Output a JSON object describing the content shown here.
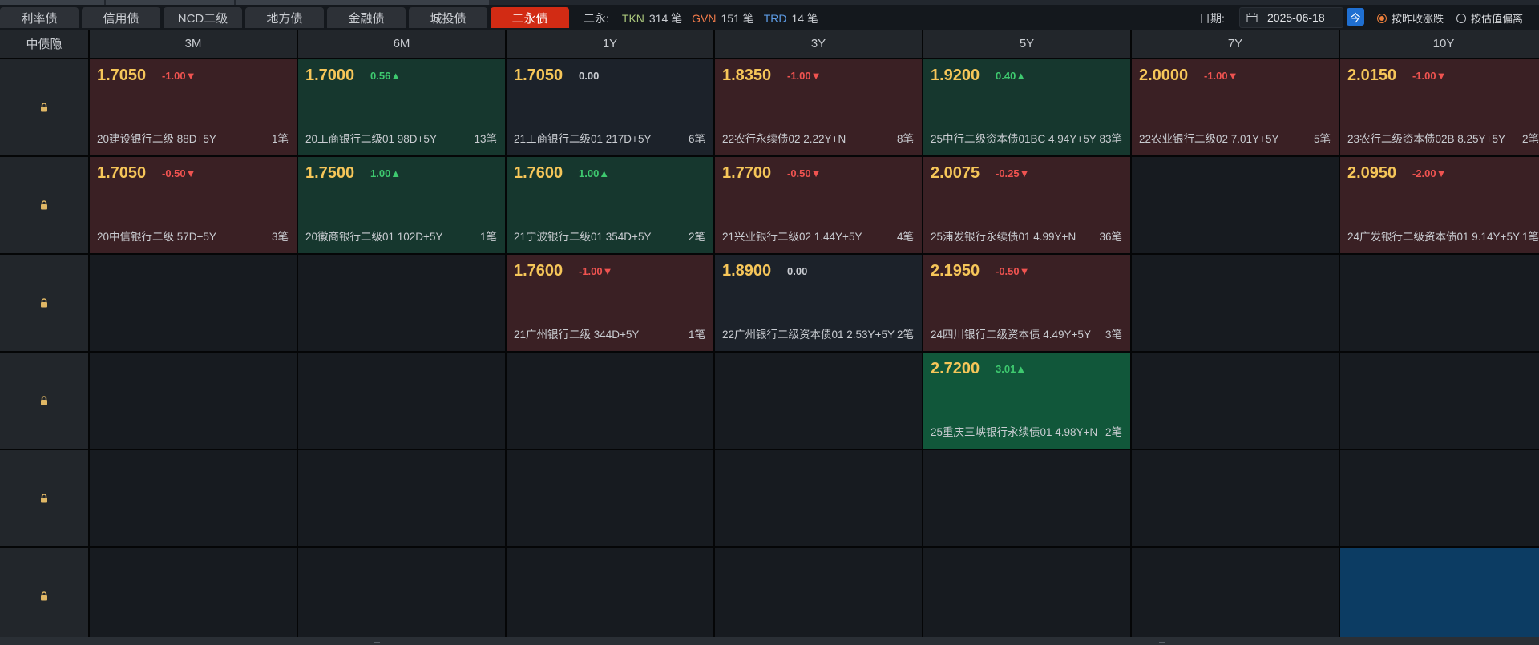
{
  "tabs": [
    {
      "label": "利率债",
      "active": false
    },
    {
      "label": "信用债",
      "active": false
    },
    {
      "label": "NCD二级",
      "active": false
    },
    {
      "label": "地方债",
      "active": false
    },
    {
      "label": "金融债",
      "active": false
    },
    {
      "label": "城投债",
      "active": false
    },
    {
      "label": "二永债",
      "active": true
    }
  ],
  "stats": {
    "prefix": "二永:",
    "tkn_label": "TKN",
    "tkn_count": "314 笔",
    "gvn_label": "GVN",
    "gvn_count": "151 笔",
    "trd_label": "TRD",
    "trd_count": "14 笔"
  },
  "date": {
    "label": "日期:",
    "value": "2025-06-18",
    "today_button": "今"
  },
  "radios": [
    {
      "label": "按昨收涨跌",
      "checked": true
    },
    {
      "label": "按估值偏离",
      "checked": false
    }
  ],
  "grid": {
    "corner_label": "中债隐",
    "columns": [
      "3M",
      "6M",
      "1Y",
      "3Y",
      "5Y",
      "7Y",
      "10Y"
    ],
    "rows": [
      [
        {
          "yield": "1.7050",
          "change": "-1.00▼",
          "dir": "dn",
          "bond": "20建设银行二级 88D+5Y",
          "count": "1笔",
          "tone": "red"
        },
        {
          "yield": "1.7000",
          "change": "0.56▲",
          "dir": "up",
          "bond": "20工商银行二级01 98D+5Y",
          "count": "13笔",
          "tone": "green"
        },
        {
          "yield": "1.7050",
          "change": "0.00",
          "dir": "flat",
          "bond": "21工商银行二级01 217D+5Y",
          "count": "6笔",
          "tone": "neutral"
        },
        {
          "yield": "1.8350",
          "change": "-1.00▼",
          "dir": "dn",
          "bond": "22农行永续债02 2.22Y+N",
          "count": "8笔",
          "tone": "red"
        },
        {
          "yield": "1.9200",
          "change": "0.40▲",
          "dir": "up",
          "bond": "25中行二级资本债01BC 4.94Y+5Y",
          "count": "83笔",
          "tone": "green"
        },
        {
          "yield": "2.0000",
          "change": "-1.00▼",
          "dir": "dn",
          "bond": "22农业银行二级02 7.01Y+5Y",
          "count": "5笔",
          "tone": "red"
        },
        {
          "yield": "2.0150",
          "change": "-1.00▼",
          "dir": "dn",
          "bond": "23农行二级资本债02B 8.25Y+5Y",
          "count": "2笔",
          "tone": "red"
        }
      ],
      [
        {
          "yield": "1.7050",
          "change": "-0.50▼",
          "dir": "dn",
          "bond": "20中信银行二级 57D+5Y",
          "count": "3笔",
          "tone": "red"
        },
        {
          "yield": "1.7500",
          "change": "1.00▲",
          "dir": "up",
          "bond": "20徽商银行二级01 102D+5Y",
          "count": "1笔",
          "tone": "green"
        },
        {
          "yield": "1.7600",
          "change": "1.00▲",
          "dir": "up",
          "bond": "21宁波银行二级01 354D+5Y",
          "count": "2笔",
          "tone": "green"
        },
        {
          "yield": "1.7700",
          "change": "-0.50▼",
          "dir": "dn",
          "bond": "21兴业银行二级02 1.44Y+5Y",
          "count": "4笔",
          "tone": "red"
        },
        {
          "yield": "2.0075",
          "change": "-0.25▼",
          "dir": "dn",
          "bond": "25浦发银行永续债01 4.99Y+N",
          "count": "36笔",
          "tone": "red"
        },
        null,
        {
          "yield": "2.0950",
          "change": "-2.00▼",
          "dir": "dn",
          "bond": "24广发银行二级资本债01 9.14Y+5Y",
          "count": "1笔",
          "tone": "red"
        }
      ],
      [
        null,
        null,
        {
          "yield": "1.7600",
          "change": "-1.00▼",
          "dir": "dn",
          "bond": "21广州银行二级 344D+5Y",
          "count": "1笔",
          "tone": "red"
        },
        {
          "yield": "1.8900",
          "change": "0.00",
          "dir": "flat",
          "bond": "22广州银行二级资本债01 2.53Y+5Y",
          "count": "2笔",
          "tone": "neutral"
        },
        {
          "yield": "2.1950",
          "change": "-0.50▼",
          "dir": "dn",
          "bond": "24四川银行二级资本债 4.49Y+5Y",
          "count": "3笔",
          "tone": "red"
        },
        null,
        null
      ],
      [
        null,
        null,
        null,
        null,
        {
          "yield": "2.7200",
          "change": "3.01▲",
          "dir": "up",
          "bond": "25重庆三峡银行永续债01 4.98Y+N",
          "count": "2笔",
          "tone": "brightgreen"
        },
        null,
        null
      ],
      [
        null,
        null,
        null,
        null,
        null,
        null,
        null
      ],
      [
        null,
        null,
        null,
        null,
        null,
        null,
        "selected"
      ]
    ]
  },
  "colors": {
    "accent_tab": "#d22b14",
    "yield_text": "#f6c659",
    "down": "#ef5350",
    "up": "#3ec96f",
    "tkn": "#a8c57a",
    "gvn": "#ef7a4a",
    "trd": "#5d9be4"
  }
}
